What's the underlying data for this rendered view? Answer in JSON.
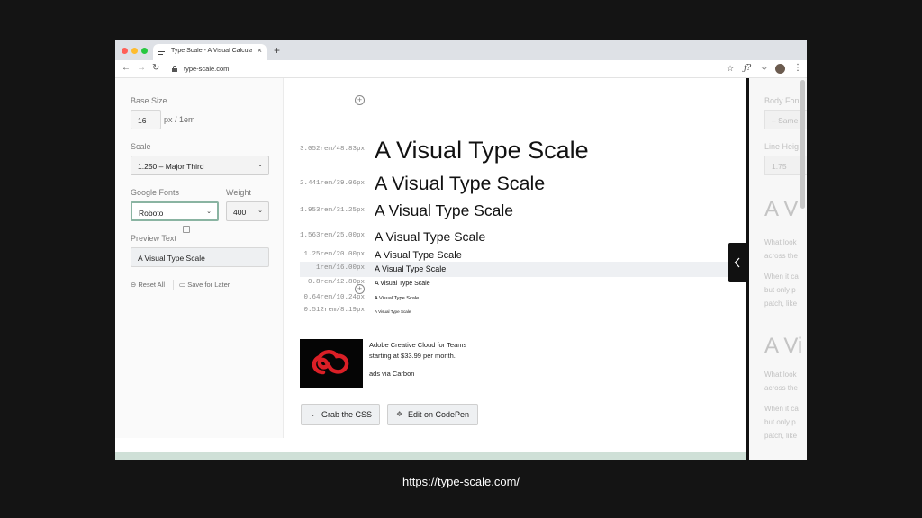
{
  "browser": {
    "tab_title": "Type Scale - A Visual Calculator",
    "tab_close": "×",
    "new_tab": "+",
    "url": "type-scale.com"
  },
  "sidebar": {
    "base_size_label": "Base Size",
    "base_size_value": "16",
    "base_size_unit": "px / 1em",
    "scale_label": "Scale",
    "scale_value": "1.250 – Major Third",
    "google_fonts_label": "Google Fonts",
    "font_value": "Roboto",
    "weight_label": "Weight",
    "weight_value": "400",
    "preview_label": "Preview Text",
    "preview_value": "A Visual Type Scale",
    "reset_all": "Reset All",
    "save_for_later": "Save for Later"
  },
  "scale": {
    "rows": [
      {
        "rem": "3.052rem/48.83px",
        "sample": "A Visual Type Scale",
        "highlighted": false
      },
      {
        "rem": "2.441rem/39.06px",
        "sample": "A Visual Type Scale",
        "highlighted": false
      },
      {
        "rem": "1.953rem/31.25px",
        "sample": "A Visual Type Scale",
        "highlighted": false
      },
      {
        "rem": "1.563rem/25.00px",
        "sample": "A Visual Type Scale",
        "highlighted": false
      },
      {
        "rem": "1.25rem/20.00px",
        "sample": "A Visual Type Scale",
        "highlighted": false
      },
      {
        "rem": "1rem/16.00px",
        "sample": "A Visual Type Scale",
        "highlighted": true
      },
      {
        "rem": "0.8rem/12.80px",
        "sample": "A Visual Type Scale",
        "highlighted": false
      },
      {
        "rem": "0.64rem/10.24px",
        "sample": "A Visual Type Scale",
        "highlighted": false
      },
      {
        "rem": "0.512rem/8.19px",
        "sample": "A Visual Type Scale",
        "highlighted": false
      }
    ]
  },
  "ad": {
    "line1": "Adobe Creative Cloud for Teams",
    "line2": "starting at $33.99 per month.",
    "via": "ads via Carbon"
  },
  "buttons": {
    "grab_css": "Grab the CSS",
    "codepen": "Edit on CodePen"
  },
  "right_panel": {
    "body_font_label": "Body Fon",
    "body_font_value": "– Same",
    "line_height_label": "Line Heig",
    "line_height_value": "1.75",
    "heading1": "A V",
    "para1_l1": "What look",
    "para1_l2": "across the",
    "para1_l3": "When it ca",
    "para1_l4": "but only p",
    "para1_l5": "patch, like",
    "heading2": "A Vi",
    "para2_l1": "What look",
    "para2_l2": "across the",
    "para2_l3": "When it ca",
    "para2_l4": "but only p",
    "para2_l5": "patch, like"
  },
  "caption": "https://type-scale.com/",
  "colors": {
    "page_background": "#141414",
    "accent_focus": "#8ab4a2",
    "footer_strip": "#cfe0d7",
    "adobe_red": "#da1f26"
  }
}
